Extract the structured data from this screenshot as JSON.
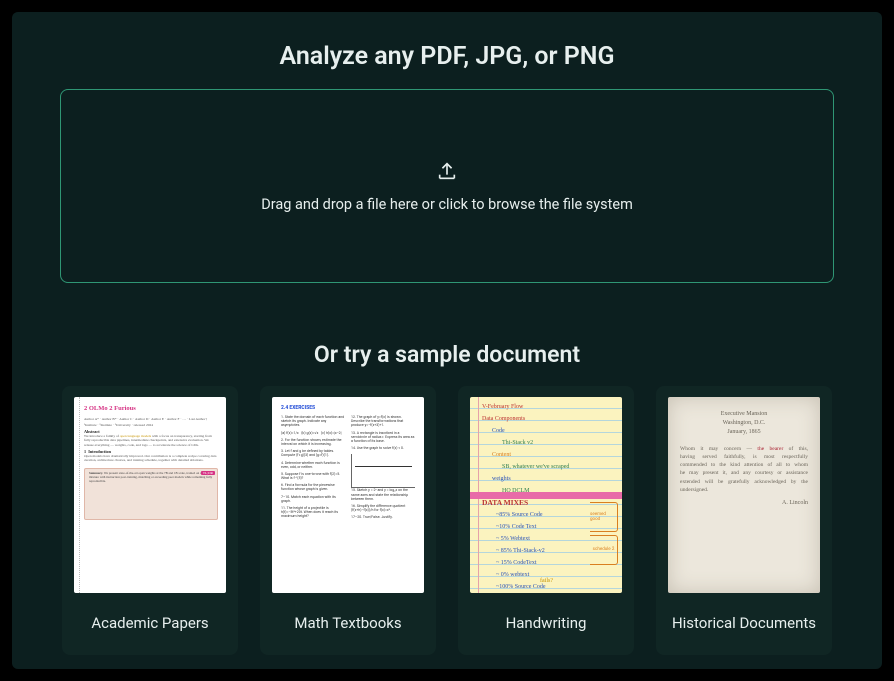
{
  "header": {
    "title": "Analyze any PDF, JPG, or PNG"
  },
  "dropzone": {
    "instruction": "Drag and drop a file here or click to browse the file system",
    "icon": "upload-icon"
  },
  "samples": {
    "heading": "Or try a sample document",
    "items": [
      {
        "label": "Academic Papers",
        "thumb_kind": "academic-paper",
        "preview": {
          "title": "2 OLMo 2 Furious",
          "section": "Abstract",
          "callout_tag": "TL;DR"
        }
      },
      {
        "label": "Math Textbooks",
        "thumb_kind": "math-textbook",
        "preview": {
          "section_heading": "2.4 EXERCISES"
        }
      },
      {
        "label": "Handwriting",
        "thumb_kind": "handwriting",
        "preview": {
          "lines": [
            "V-February Flow",
            "Data Components",
            "Code",
            "Thi-Stack v2",
            "Content",
            "SB, whatever we've scraped",
            "weights",
            "HQ DCLM",
            "DATA  MIXES",
            "~85%  Source Code",
            "~10%  Code Text",
            "~ 5%  Webtext",
            "~ 85%  Thi-Stack-v2",
            "~ 15%  CodeText",
            "~ 0%   webtext",
            "~100%  Source Code"
          ],
          "bracket_labels": [
            "seemed good",
            "schedule 2"
          ],
          "caret_note": "fails?"
        }
      },
      {
        "label": "Historical Documents",
        "thumb_kind": "historical-letter",
        "preview": {
          "header_line1": "Executive Mansion",
          "header_line2": "Washington, D.C.",
          "date_line": "January, 1865",
          "signature": "A. Lincoln"
        }
      }
    ]
  }
}
